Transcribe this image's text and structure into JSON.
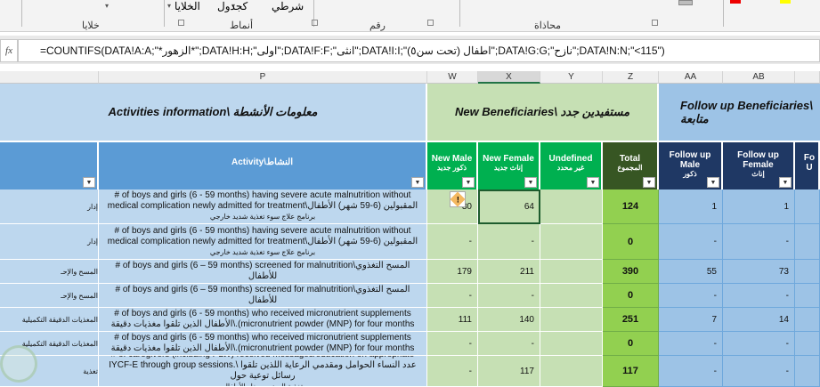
{
  "ribbon": {
    "groups": [
      "خلايا",
      "أنماط",
      "رقم",
      "محاذاة"
    ],
    "styles_items": [
      "شرطي",
      "كجدول",
      "الخلايا"
    ]
  },
  "formula_bar": {
    "fx_label": "fx",
    "formula": "=COUNTIFS(DATA!A:A;\"*الزهور*\";DATA!H:H;\"اولى\";DATA!F:F;\"انثى\";DATA!I:I;\"اطفال (تحت سن٥)\";DATA!G:G;\"نازح\";DATA!N:N;\"<115\")"
  },
  "columns": [
    "P",
    "W",
    "X",
    "Y",
    "Z",
    "AA",
    "AB"
  ],
  "sections": {
    "activities": "Activities information\\ معلومات الأنشطة",
    "new": "New Beneficiaries\\ مستفيدين جدد",
    "followup": "Follow up Beneficiaries\\ متابعة"
  },
  "headers": {
    "activity": "Activity\\النشاط",
    "new_male": "New Male",
    "new_male_ar": "ذكور جديد",
    "new_female": "New Female",
    "new_female_ar": "إناث جديد",
    "undefined": "Undefined",
    "undefined_ar": "غير محدد",
    "total": "Total",
    "total_ar": "المجموع",
    "fu_male": "Follow up Male",
    "fu_male_ar": "ذكور",
    "fu_female": "Follow up Female",
    "fu_female_ar": "إناث",
    "fu_un": "Fo U"
  },
  "rows": [
    {
      "left": "إدار",
      "activity": "# of boys and girls (6 - 59 months) having severe acute malnutrition without medical complication newly admitted for  treatment\\المقبولين (6-59 شهر) الأطفال",
      "activity_ar": "برنامج علاج سوء تغذية شديد خارجي",
      "w": "30",
      "x": "64",
      "y": "",
      "z": "124",
      "aa": "1",
      "ab": "1"
    },
    {
      "left": "إدار",
      "activity": "# of boys and girls (6 - 59 months) having severe acute malnutrition without medical complication newly admitted for  treatment\\المقبولين (6-59 شهر) الأطفال",
      "activity_ar": "برنامج علاج سوء تغذية شديد خارجي",
      "w": "-",
      "x": "-",
      "y": "",
      "z": "0",
      "aa": "-",
      "ab": "-"
    },
    {
      "left": "المسح والإحـ",
      "activity": "# of boys and girls (6 – 59 months) screened for malnutrition\\المسح التغذوي للأطفال",
      "activity_ar": "",
      "w": "179",
      "x": "211",
      "y": "",
      "z": "390",
      "aa": "55",
      "ab": "73"
    },
    {
      "left": "المسح والإحـ",
      "activity": "# of boys and girls (6 – 59 months) screened for malnutrition\\المسح التغذوي للأطفال",
      "activity_ar": "",
      "w": "-",
      "x": "-",
      "y": "",
      "z": "0",
      "aa": "-",
      "ab": "-"
    },
    {
      "left": "المغذيات الدقيقة التكميلية",
      "activity": "# of boys and girls (6 - 59 months) who received micronutrient supplements الأطفال الذين تلقوا مغذيات دقيقة\\.(micronutrient powder (MNP) for four months",
      "activity_ar": "",
      "w": "111",
      "x": "140",
      "y": "",
      "z": "251",
      "aa": "7",
      "ab": "14"
    },
    {
      "left": "المغذيات الدقيقة التكميلية",
      "activity": "# of boys and girls (6 - 59 months) who received micronutrient supplements الأطفال الذين تلقوا مغذيات دقيقة\\.(micronutrient powder (MNP) for four months",
      "activity_ar": "",
      "w": "-",
      "x": "-",
      "y": "",
      "z": "0",
      "aa": "-",
      "ab": "-"
    },
    {
      "left": "تغذية",
      "activity": "# of caregivers (including PLW) received messages/education on appropriate IYCF-E through group sessions.\\ عدد النساء الحوامل ومقدمي الرعاية اللذين تلقوا رسائل توعية حول",
      "activity_ar": "تغذية الرضع وصغار الأطفال",
      "w": "-",
      "x": "117",
      "y": "",
      "z": "117",
      "aa": "-",
      "ab": "-"
    }
  ]
}
